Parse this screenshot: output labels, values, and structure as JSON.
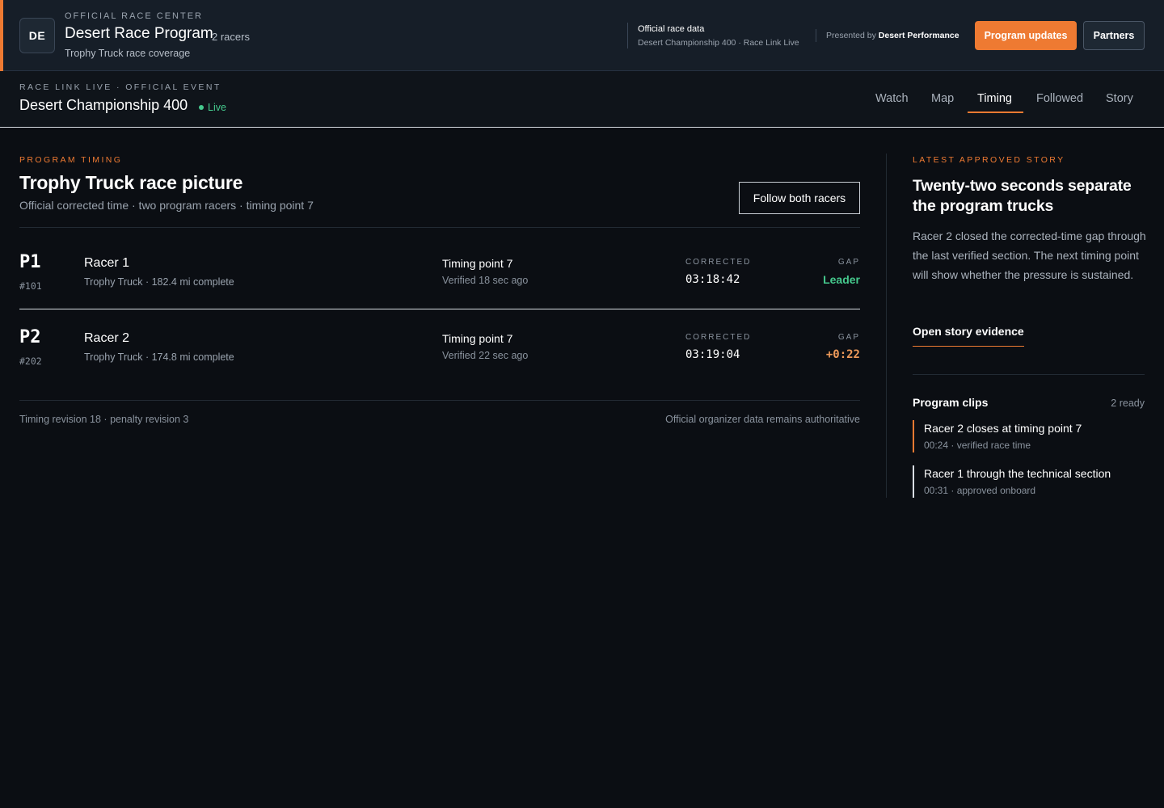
{
  "program": {
    "badge": "DE",
    "eyebrow": "OFFICIAL RACE CENTER",
    "title": "Desert Race Program",
    "racer_count": "2 racers",
    "subtitle": "Trophy Truck race coverage",
    "official_title": "Official race data",
    "official_sub": "Desert Championship 400 · Race Link Live",
    "presented_prefix": "Presented by",
    "presented_sponsor": "Desert Performance",
    "updates_button": "Program updates",
    "partners_button": "Partners",
    "accent_color": "#ee7a32"
  },
  "event": {
    "eyebrow": "RACE LINK LIVE · OFFICIAL EVENT",
    "title": "Desert Championship 400",
    "status": "Live",
    "status_color": "#45c98d",
    "tabs": [
      {
        "label": "Watch",
        "active": false
      },
      {
        "label": "Map",
        "active": false
      },
      {
        "label": "Timing",
        "active": true
      },
      {
        "label": "Followed",
        "active": false
      },
      {
        "label": "Story",
        "active": false
      }
    ]
  },
  "timing": {
    "eyebrow": "PROGRAM TIMING",
    "title": "Trophy Truck race picture",
    "subtitle": "Official corrected time · two program racers · timing point 7",
    "follow_button": "Follow both racers",
    "corrected_label": "CORRECTED",
    "gap_label": "GAP",
    "rows": [
      {
        "position": "P1",
        "number": "#101",
        "name": "Racer 1",
        "meta": "Trophy Truck · 182.4 mi complete",
        "timing_point": "Timing point 7",
        "verified": "Verified 18 sec ago",
        "corrected": "03:18:42",
        "gap": "Leader"
      },
      {
        "position": "P2",
        "number": "#202",
        "name": "Racer 2",
        "meta": "Trophy Truck · 174.8 mi complete",
        "timing_point": "Timing point 7",
        "verified": "Verified 22 sec ago",
        "corrected": "03:19:04",
        "gap": "+0:22"
      }
    ],
    "footer_left": "Timing revision 18 · penalty revision 3",
    "footer_right": "Official organizer data remains authoritative"
  },
  "story": {
    "eyebrow": "LATEST APPROVED STORY",
    "title": "Twenty-two seconds separate the program trucks",
    "body": "Racer 2 closed the corrected-time gap through the last verified section. The next timing point will show whether the pressure is sustained.",
    "link": "Open story evidence",
    "clips_title": "Program clips",
    "clips_count": "2 ready",
    "clips": [
      {
        "title": "Racer 2 closes at timing point 7",
        "meta": "00:24 · verified race time"
      },
      {
        "title": "Racer 1 through the technical section",
        "meta": "00:31 · approved onboard"
      }
    ]
  }
}
